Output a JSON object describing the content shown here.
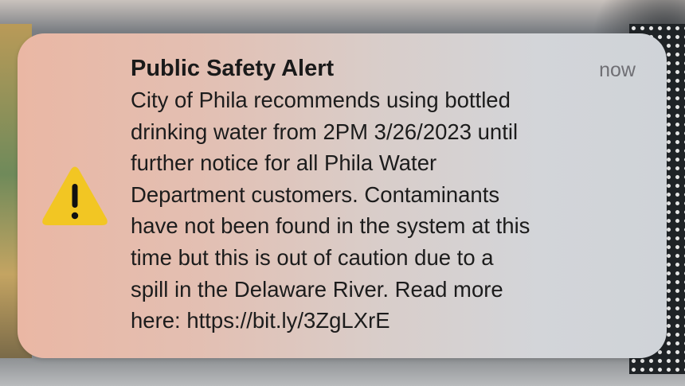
{
  "notification": {
    "title": "Public Safety Alert",
    "timestamp": "now",
    "icon": "warning-triangle-icon",
    "accent_color": "#f2c623",
    "message_lines": [
      "City of Phila recommends using bottled",
      "drinking water from 2PM 3/26/2023 until",
      "further notice for all Phila Water",
      "Department customers. Contaminants",
      "have not been found in the system at this",
      "time but this is out of caution due to a",
      "spill in the Delaware River. Read more",
      "here: https://bit.ly/3ZgLXrE"
    ]
  }
}
